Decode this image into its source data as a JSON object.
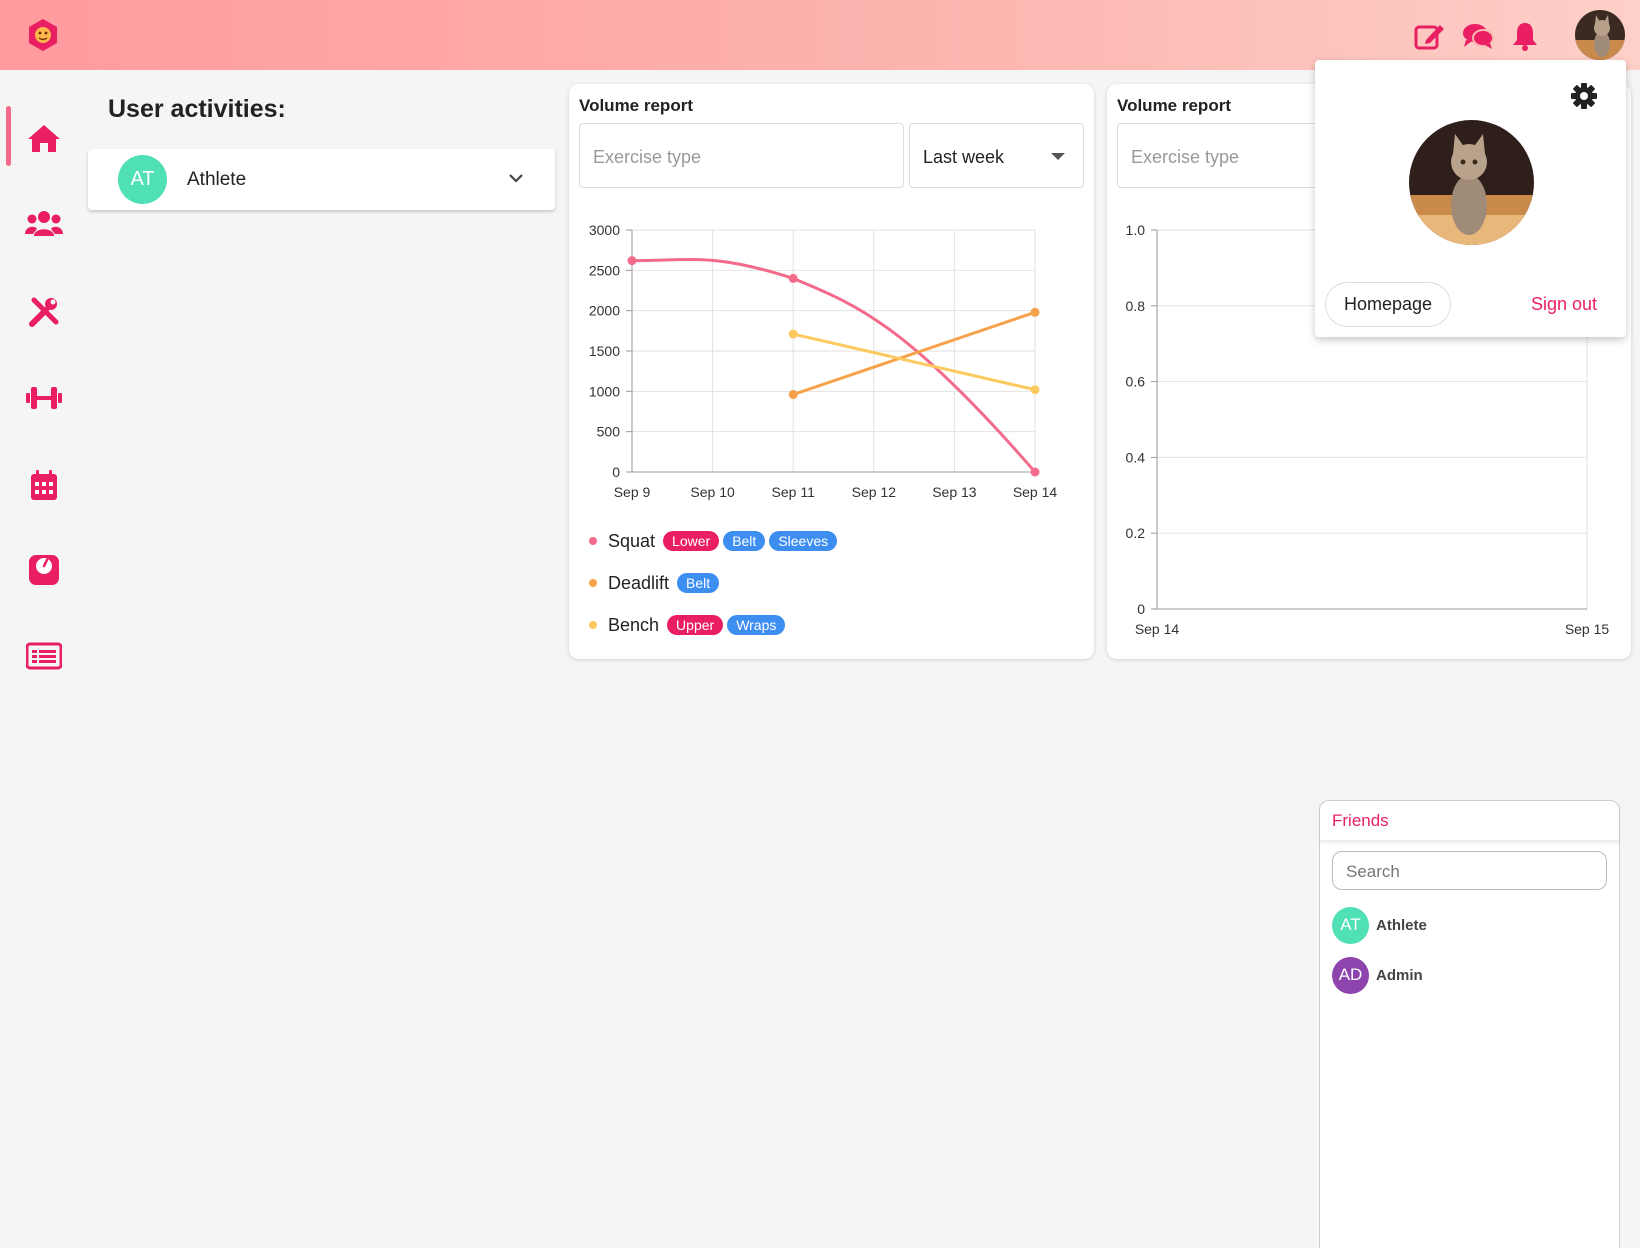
{
  "colors": {
    "accent": "#e91e63",
    "squat": "#f46a8a",
    "deadlift": "#f7a14a",
    "bench": "#fcc95e",
    "tag_red": "#e91e63",
    "tag_blue": "#3d8ef0"
  },
  "header": {
    "icons": [
      "lion-logo-icon",
      "edit-icon",
      "chat-icon",
      "bell-icon"
    ]
  },
  "sidebar": {
    "items": [
      "home-icon",
      "users-icon",
      "tools-icon",
      "dumbbell-icon",
      "calendar-icon",
      "scale-icon",
      "list-icon"
    ]
  },
  "activities": {
    "title": "User activities:",
    "user": {
      "initials": "AT",
      "name": "Athlete"
    }
  },
  "report1": {
    "title": "Volume report",
    "exercise_placeholder": "Exercise type",
    "period": "Last week",
    "legend": [
      {
        "name": "Squat",
        "tags": [
          {
            "label": "Lower",
            "kind": "red"
          },
          {
            "label": "Belt",
            "kind": "blue"
          },
          {
            "label": "Sleeves",
            "kind": "blue"
          }
        ]
      },
      {
        "name": "Deadlift",
        "tags": [
          {
            "label": "Belt",
            "kind": "blue"
          }
        ]
      },
      {
        "name": "Bench",
        "tags": [
          {
            "label": "Upper",
            "kind": "red"
          },
          {
            "label": "Wraps",
            "kind": "blue"
          }
        ]
      }
    ]
  },
  "report2": {
    "title": "Volume report",
    "exercise_placeholder": "Exercise type"
  },
  "popup": {
    "homepage": "Homepage",
    "signout": "Sign out"
  },
  "friends": {
    "title": "Friends",
    "search_placeholder": "Search",
    "list": [
      {
        "initials": "AT",
        "name": "Athlete",
        "color": "#4fe0b6"
      },
      {
        "initials": "AD",
        "name": "Admin",
        "color": "#8e44ad"
      }
    ]
  },
  "chart_data": [
    {
      "type": "line",
      "x": [
        "Sep 9",
        "Sep 10",
        "Sep 11",
        "Sep 12",
        "Sep 13",
        "Sep 14"
      ],
      "yticks": [
        0,
        500,
        1000,
        1500,
        2000,
        2500,
        3000
      ],
      "ylim": [
        0,
        3000
      ],
      "grid": true,
      "series": [
        {
          "name": "Squat",
          "color": "#f46a8a",
          "points": [
            {
              "x": "Sep 9",
              "y": 2620
            },
            {
              "x": "Sep 11",
              "y": 2400
            },
            {
              "x": "Sep 14",
              "y": 0
            }
          ]
        },
        {
          "name": "Deadlift",
          "color": "#f7a14a",
          "points": [
            {
              "x": "Sep 11",
              "y": 960
            },
            {
              "x": "Sep 14",
              "y": 1980
            }
          ]
        },
        {
          "name": "Bench",
          "color": "#fcc95e",
          "points": [
            {
              "x": "Sep 11",
              "y": 1710
            },
            {
              "x": "Sep 14",
              "y": 1020
            }
          ]
        }
      ]
    },
    {
      "type": "line",
      "x": [
        "Sep 14",
        "Sep 15"
      ],
      "yticks": [
        "0",
        "0.2",
        "0.4",
        "0.6",
        "0.8",
        "1.0"
      ],
      "ylim": [
        0,
        1
      ],
      "grid": true,
      "series": []
    }
  ]
}
